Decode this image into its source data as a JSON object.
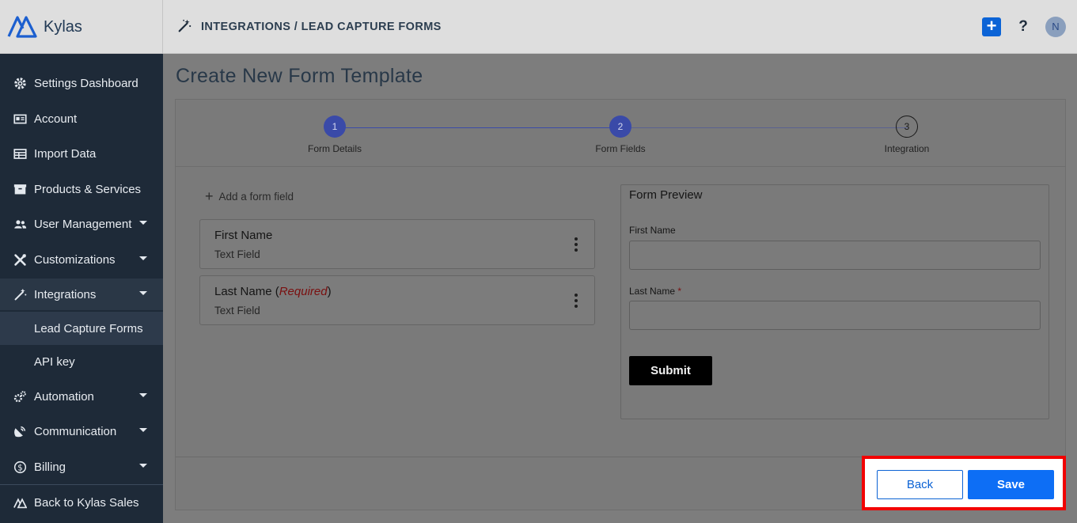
{
  "app": {
    "name": "Kylas"
  },
  "header": {
    "breadcrumb": "INTEGRATIONS / LEAD CAPTURE FORMS",
    "breadcrumb_icon": "magic-wand-icon",
    "actions": {
      "add_icon": "plus-icon",
      "help_label": "?",
      "avatar_initial": "N"
    }
  },
  "sidebar": {
    "items": [
      {
        "label": "Settings Dashboard",
        "icon": "gear-icon"
      },
      {
        "label": "Account",
        "icon": "id-card-icon"
      },
      {
        "label": "Import Data",
        "icon": "table-icon"
      },
      {
        "label": "Products & Services",
        "icon": "box-icon"
      },
      {
        "label": "User Management",
        "icon": "users-icon"
      },
      {
        "label": "Customizations",
        "icon": "tools-icon"
      },
      {
        "label": "Integrations",
        "icon": "magic-wand-icon"
      },
      {
        "label": "Automation",
        "icon": "cogs-icon"
      },
      {
        "label": "Communication",
        "icon": "satellite-icon"
      },
      {
        "label": "Billing",
        "icon": "dollar-icon"
      },
      {
        "label": "Back to Kylas Sales",
        "icon": "kylas-logo-icon"
      }
    ],
    "subitems": [
      {
        "label": "Lead Capture Forms"
      },
      {
        "label": "API key"
      }
    ]
  },
  "main": {
    "title": "Create New Form Template",
    "steps": [
      {
        "number": "1",
        "label": "Form Details"
      },
      {
        "number": "2",
        "label": "Form Fields"
      },
      {
        "number": "3",
        "label": "Integration"
      }
    ],
    "add_field_label": "Add a form field",
    "fields": [
      {
        "name": "First Name",
        "type": "Text Field"
      },
      {
        "name": "Last Name",
        "required_text": "Required",
        "type": "Text Field"
      }
    ],
    "preview": {
      "title": "Form Preview",
      "fields": [
        {
          "label": "First Name"
        },
        {
          "label": "Last Name",
          "required_mark": "*"
        }
      ],
      "submit_label": "Submit"
    },
    "footer": {
      "back_label": "Back",
      "save_label": "Save"
    }
  },
  "colors": {
    "accent": "#0d6ef5",
    "sidebar_bg": "#1e2a38",
    "highlight_box": "#f20000",
    "step_active": "#3a4aa8"
  }
}
